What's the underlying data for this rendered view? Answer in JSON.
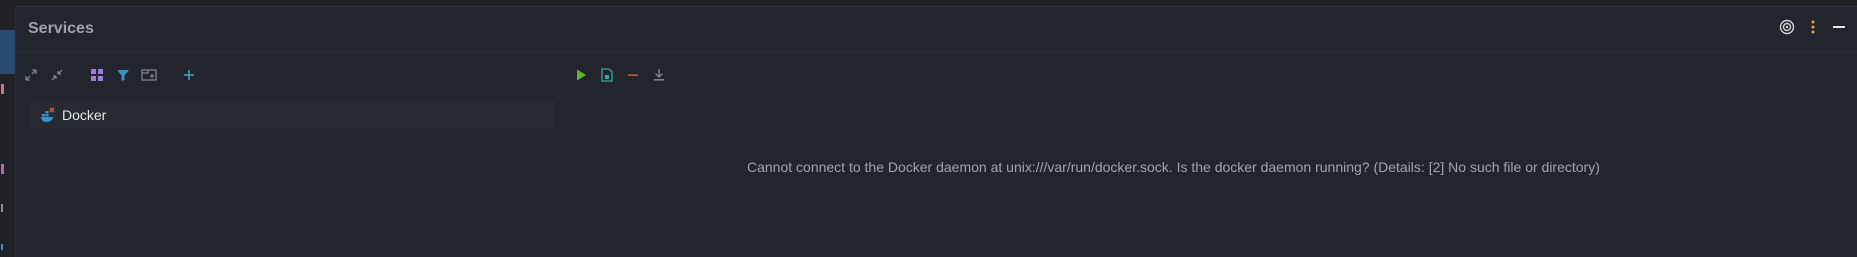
{
  "panel": {
    "title": "Services"
  },
  "header": {
    "icons": [
      "target-icon",
      "more-vertical-icon",
      "minimize-icon"
    ]
  },
  "toolbar_left": {
    "icons": [
      "expand-all-icon",
      "collapse-all-icon",
      "group-icon",
      "filter-icon",
      "new-tab-icon",
      "add-icon"
    ]
  },
  "toolbar_right": {
    "icons": [
      "run-icon",
      "deploy-icon",
      "remove-icon",
      "download-icon"
    ]
  },
  "tree": {
    "items": [
      {
        "label": "Docker",
        "icon": "docker-icon"
      }
    ]
  },
  "detail": {
    "message": "Cannot connect to the Docker daemon at unix:///var/run/docker.sock. Is the docker daemon running? (Details: [2] No such file or directory)"
  },
  "colors": {
    "background": "#22252c",
    "accent_blue": "#3592c4",
    "run_green": "#5fb833",
    "remove_red": "#c75450",
    "group_purple": "#9e7cdb",
    "menu_yellow": "#e0a33a"
  }
}
